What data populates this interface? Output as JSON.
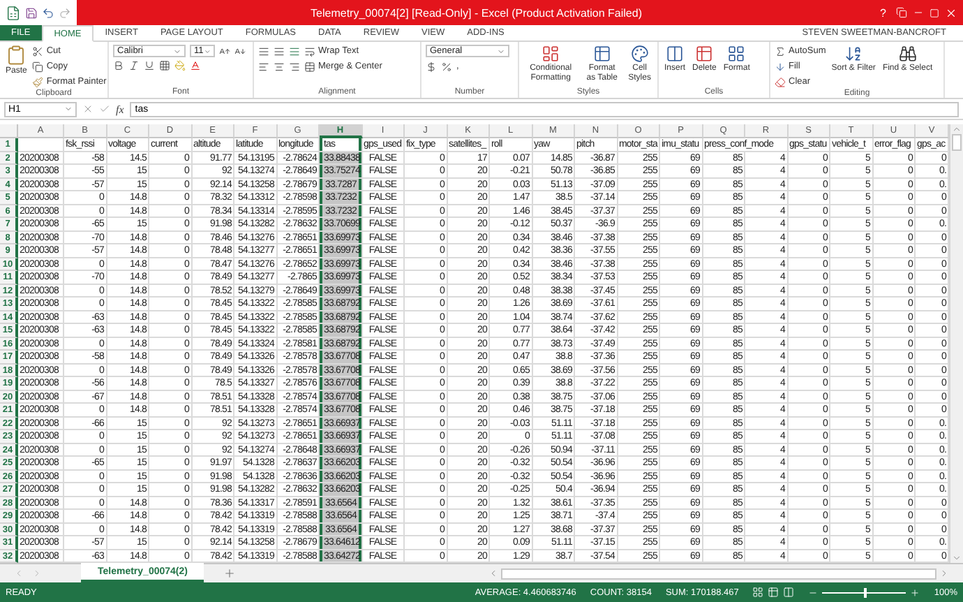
{
  "window": {
    "title": "Telemetry_00074[2]  [Read-Only] - Excel (Product Activation Failed)",
    "help": "?"
  },
  "ribbon": {
    "tabs": [
      {
        "label": "FILE",
        "kind": "file",
        "selected": false
      },
      {
        "label": "HOME",
        "kind": "tab",
        "selected": true
      },
      {
        "label": "INSERT",
        "kind": "tab",
        "selected": false
      },
      {
        "label": "PAGE LAYOUT",
        "kind": "tab",
        "selected": false
      },
      {
        "label": "FORMULAS",
        "kind": "tab",
        "selected": false
      },
      {
        "label": "DATA",
        "kind": "tab",
        "selected": false
      },
      {
        "label": "REVIEW",
        "kind": "tab",
        "selected": false
      },
      {
        "label": "VIEW",
        "kind": "tab",
        "selected": false
      },
      {
        "label": "ADD-INS",
        "kind": "tab",
        "selected": false
      }
    ],
    "account": "STEVEN SWEETMAN-BANCROFT",
    "clipboard": {
      "paste": "Paste",
      "cut": "Cut",
      "copy": "Copy",
      "format_painter": "Format Painter",
      "label": "Clipboard"
    },
    "font": {
      "name": "Calibri",
      "size": "11",
      "label": "Font"
    },
    "alignment": {
      "wrap": "Wrap Text",
      "merge": "Merge & Center",
      "label": "Alignment"
    },
    "number": {
      "format": "General",
      "comma": ",",
      "label": "Number"
    },
    "styles": {
      "conditional": "Conditional Formatting",
      "table": "Format as Table",
      "cell_styles": "Cell Styles",
      "label": "Styles"
    },
    "cells": {
      "insert": "Insert",
      "delete": "Delete",
      "format": "Format",
      "label": "Cells"
    },
    "editing": {
      "autosum": "AutoSum",
      "fill": "Fill",
      "clear": "Clear",
      "sort": "Sort & Filter",
      "find": "Find & Select",
      "label": "Editing"
    }
  },
  "formula_bar": {
    "name_box": "H1",
    "fx": "fx",
    "value": "tas"
  },
  "sheet": {
    "columns": [
      {
        "letter": "A",
        "kind": "text",
        "selected": false
      },
      {
        "letter": "B",
        "kind": "number",
        "selected": false
      },
      {
        "letter": "C",
        "kind": "number",
        "selected": false
      },
      {
        "letter": "D",
        "kind": "number",
        "selected": false
      },
      {
        "letter": "E",
        "kind": "number",
        "selected": false
      },
      {
        "letter": "F",
        "kind": "number",
        "selected": false
      },
      {
        "letter": "G",
        "kind": "number",
        "selected": false
      },
      {
        "letter": "H",
        "kind": "number",
        "selected": true
      },
      {
        "letter": "I",
        "kind": "boolean",
        "selected": false
      },
      {
        "letter": "J",
        "kind": "number",
        "selected": false
      },
      {
        "letter": "K",
        "kind": "number",
        "selected": false
      },
      {
        "letter": "L",
        "kind": "number",
        "selected": false
      },
      {
        "letter": "M",
        "kind": "number",
        "selected": false
      },
      {
        "letter": "N",
        "kind": "number",
        "selected": false
      },
      {
        "letter": "O",
        "kind": "number",
        "selected": false
      },
      {
        "letter": "P",
        "kind": "number",
        "selected": false
      },
      {
        "letter": "Q",
        "kind": "number",
        "selected": false
      },
      {
        "letter": "R",
        "kind": "number",
        "selected": false
      },
      {
        "letter": "S",
        "kind": "number",
        "selected": false
      },
      {
        "letter": "T",
        "kind": "number",
        "selected": false
      },
      {
        "letter": "U",
        "kind": "number",
        "selected": false
      },
      {
        "letter": "V",
        "kind": "number",
        "selected": false
      }
    ],
    "rows": [
      {
        "number": "1",
        "kind": "header",
        "active": true,
        "cells": [
          null,
          "fsk_rssi",
          "voltage",
          "current",
          "altitude",
          "latitude",
          "longitude",
          "tas",
          "gps_used",
          "fix_type",
          "satellites_",
          "roll",
          "yaw",
          "pitch",
          "motor_sta",
          "imu_statu",
          "press_conf_mode",
          null,
          "gps_statu",
          "vehicle_t",
          "error_flag",
          "gps_ac"
        ]
      },
      {
        "number": "2",
        "kind": "data",
        "active": false,
        "cells": [
          "20200308",
          "-58",
          "14.5",
          "0",
          "91.77",
          "54.13195",
          "-2.78624",
          "33.88438",
          "FALSE",
          "0",
          "17",
          "0.07",
          "14.85",
          "-36.87",
          "255",
          "69",
          "85",
          "4",
          "0",
          "5",
          "0",
          "0"
        ]
      },
      {
        "number": "3",
        "kind": "data",
        "active": false,
        "cells": [
          "20200308",
          "-55",
          "15",
          "0",
          "92",
          "54.13274",
          "-2.78649",
          "33.75274",
          "FALSE",
          "0",
          "20",
          "-0.21",
          "50.78",
          "-36.85",
          "255",
          "69",
          "85",
          "4",
          "0",
          "5",
          "0",
          "0."
        ]
      },
      {
        "number": "4",
        "kind": "data",
        "active": false,
        "cells": [
          "20200308",
          "-57",
          "15",
          "0",
          "92.14",
          "54.13258",
          "-2.78679",
          "33.7287",
          "FALSE",
          "0",
          "20",
          "0.03",
          "51.13",
          "-37.09",
          "255",
          "69",
          "85",
          "4",
          "0",
          "5",
          "0",
          "0."
        ]
      },
      {
        "number": "5",
        "kind": "data",
        "active": false,
        "cells": [
          "20200308",
          "0",
          "14.8",
          "0",
          "78.32",
          "54.13312",
          "-2.78598",
          "33.7232",
          "FALSE",
          "0",
          "20",
          "1.47",
          "38.5",
          "-37.14",
          "255",
          "69",
          "85",
          "4",
          "0",
          "5",
          "0",
          "0"
        ]
      },
      {
        "number": "6",
        "kind": "data",
        "active": false,
        "cells": [
          "20200308",
          "0",
          "14.8",
          "0",
          "78.34",
          "54.13314",
          "-2.78595",
          "33.7232",
          "FALSE",
          "0",
          "20",
          "1.46",
          "38.45",
          "-37.37",
          "255",
          "69",
          "85",
          "4",
          "0",
          "5",
          "0",
          "0"
        ]
      },
      {
        "number": "7",
        "kind": "data",
        "active": false,
        "cells": [
          "20200308",
          "-65",
          "15",
          "0",
          "91.98",
          "54.13282",
          "-2.78632",
          "33.70699",
          "FALSE",
          "0",
          "20",
          "-0.12",
          "50.37",
          "-36.9",
          "255",
          "69",
          "85",
          "4",
          "0",
          "5",
          "0",
          "0."
        ]
      },
      {
        "number": "8",
        "kind": "data",
        "active": false,
        "cells": [
          "20200308",
          "-70",
          "14.8",
          "0",
          "78.46",
          "54.13276",
          "-2.78651",
          "33.69973",
          "FALSE",
          "0",
          "20",
          "0.34",
          "38.46",
          "-37.38",
          "255",
          "69",
          "85",
          "4",
          "0",
          "5",
          "0",
          "0"
        ]
      },
      {
        "number": "9",
        "kind": "data",
        "active": false,
        "cells": [
          "20200308",
          "-57",
          "14.8",
          "0",
          "78.48",
          "54.13277",
          "-2.78651",
          "33.69973",
          "FALSE",
          "0",
          "20",
          "0.42",
          "38.36",
          "-37.55",
          "255",
          "69",
          "85",
          "4",
          "0",
          "5",
          "0",
          "0"
        ]
      },
      {
        "number": "10",
        "kind": "data",
        "active": false,
        "cells": [
          "20200308",
          "0",
          "14.8",
          "0",
          "78.47",
          "54.13276",
          "-2.78652",
          "33.69973",
          "FALSE",
          "0",
          "20",
          "0.34",
          "38.46",
          "-37.38",
          "255",
          "69",
          "85",
          "4",
          "0",
          "5",
          "0",
          "0"
        ]
      },
      {
        "number": "11",
        "kind": "data",
        "active": false,
        "cells": [
          "20200308",
          "-70",
          "14.8",
          "0",
          "78.49",
          "54.13277",
          "-2.7865",
          "33.69973",
          "FALSE",
          "0",
          "20",
          "0.52",
          "38.34",
          "-37.53",
          "255",
          "69",
          "85",
          "4",
          "0",
          "5",
          "0",
          "0"
        ]
      },
      {
        "number": "12",
        "kind": "data",
        "active": false,
        "cells": [
          "20200308",
          "0",
          "14.8",
          "0",
          "78.52",
          "54.13279",
          "-2.78649",
          "33.69973",
          "FALSE",
          "0",
          "20",
          "0.48",
          "38.38",
          "-37.45",
          "255",
          "69",
          "85",
          "4",
          "0",
          "5",
          "0",
          "0"
        ]
      },
      {
        "number": "13",
        "kind": "data",
        "active": false,
        "cells": [
          "20200308",
          "0",
          "14.8",
          "0",
          "78.45",
          "54.13322",
          "-2.78585",
          "33.68792",
          "FALSE",
          "0",
          "20",
          "1.26",
          "38.69",
          "-37.61",
          "255",
          "69",
          "85",
          "4",
          "0",
          "5",
          "0",
          "0"
        ]
      },
      {
        "number": "14",
        "kind": "data",
        "active": false,
        "cells": [
          "20200308",
          "-63",
          "14.8",
          "0",
          "78.45",
          "54.13322",
          "-2.78585",
          "33.68792",
          "FALSE",
          "0",
          "20",
          "1.04",
          "38.74",
          "-37.62",
          "255",
          "69",
          "85",
          "4",
          "0",
          "5",
          "0",
          "0"
        ]
      },
      {
        "number": "15",
        "kind": "data",
        "active": false,
        "cells": [
          "20200308",
          "-63",
          "14.8",
          "0",
          "78.45",
          "54.13322",
          "-2.78585",
          "33.68792",
          "FALSE",
          "0",
          "20",
          "0.77",
          "38.64",
          "-37.42",
          "255",
          "69",
          "85",
          "4",
          "0",
          "5",
          "0",
          "0"
        ]
      },
      {
        "number": "16",
        "kind": "data",
        "active": false,
        "cells": [
          "20200308",
          "0",
          "14.8",
          "0",
          "78.49",
          "54.13324",
          "-2.78581",
          "33.68792",
          "FALSE",
          "0",
          "20",
          "0.77",
          "38.73",
          "-37.49",
          "255",
          "69",
          "85",
          "4",
          "0",
          "5",
          "0",
          "0"
        ]
      },
      {
        "number": "17",
        "kind": "data",
        "active": false,
        "cells": [
          "20200308",
          "-58",
          "14.8",
          "0",
          "78.49",
          "54.13326",
          "-2.78578",
          "33.67708",
          "FALSE",
          "0",
          "20",
          "0.47",
          "38.8",
          "-37.36",
          "255",
          "69",
          "85",
          "4",
          "0",
          "5",
          "0",
          "0"
        ]
      },
      {
        "number": "18",
        "kind": "data",
        "active": false,
        "cells": [
          "20200308",
          "0",
          "14.8",
          "0",
          "78.49",
          "54.13326",
          "-2.78578",
          "33.67708",
          "FALSE",
          "0",
          "20",
          "0.65",
          "38.69",
          "-37.56",
          "255",
          "69",
          "85",
          "4",
          "0",
          "5",
          "0",
          "0"
        ]
      },
      {
        "number": "19",
        "kind": "data",
        "active": false,
        "cells": [
          "20200308",
          "-56",
          "14.8",
          "0",
          "78.5",
          "54.13327",
          "-2.78576",
          "33.67708",
          "FALSE",
          "0",
          "20",
          "0.39",
          "38.8",
          "-37.22",
          "255",
          "69",
          "85",
          "4",
          "0",
          "5",
          "0",
          "0"
        ]
      },
      {
        "number": "20",
        "kind": "data",
        "active": false,
        "cells": [
          "20200308",
          "-67",
          "14.8",
          "0",
          "78.51",
          "54.13328",
          "-2.78574",
          "33.67708",
          "FALSE",
          "0",
          "20",
          "0.38",
          "38.75",
          "-37.06",
          "255",
          "69",
          "85",
          "4",
          "0",
          "5",
          "0",
          "0"
        ]
      },
      {
        "number": "21",
        "kind": "data",
        "active": false,
        "cells": [
          "20200308",
          "0",
          "14.8",
          "0",
          "78.51",
          "54.13328",
          "-2.78574",
          "33.67708",
          "FALSE",
          "0",
          "20",
          "0.46",
          "38.75",
          "-37.18",
          "255",
          "69",
          "85",
          "4",
          "0",
          "5",
          "0",
          "0"
        ]
      },
      {
        "number": "22",
        "kind": "data",
        "active": false,
        "cells": [
          "20200308",
          "-66",
          "15",
          "0",
          "92",
          "54.13273",
          "-2.78651",
          "33.66937",
          "FALSE",
          "0",
          "20",
          "-0.03",
          "51.11",
          "-37.18",
          "255",
          "69",
          "85",
          "4",
          "0",
          "5",
          "0",
          "0."
        ]
      },
      {
        "number": "23",
        "kind": "data",
        "active": false,
        "cells": [
          "20200308",
          "0",
          "15",
          "0",
          "92",
          "54.13273",
          "-2.78651",
          "33.66937",
          "FALSE",
          "0",
          "20",
          "0",
          "51.11",
          "-37.08",
          "255",
          "69",
          "85",
          "4",
          "0",
          "5",
          "0",
          "0."
        ]
      },
      {
        "number": "24",
        "kind": "data",
        "active": false,
        "cells": [
          "20200308",
          "0",
          "15",
          "0",
          "92",
          "54.13274",
          "-2.78648",
          "33.66937",
          "FALSE",
          "0",
          "20",
          "-0.26",
          "50.94",
          "-37.11",
          "255",
          "69",
          "85",
          "4",
          "0",
          "5",
          "0",
          "0."
        ]
      },
      {
        "number": "25",
        "kind": "data",
        "active": false,
        "cells": [
          "20200308",
          "-65",
          "15",
          "0",
          "91.97",
          "54.1328",
          "-2.78637",
          "33.66203",
          "FALSE",
          "0",
          "20",
          "-0.32",
          "50.54",
          "-36.96",
          "255",
          "69",
          "85",
          "4",
          "0",
          "5",
          "0",
          "0."
        ]
      },
      {
        "number": "26",
        "kind": "data",
        "active": false,
        "cells": [
          "20200308",
          "0",
          "15",
          "0",
          "91.98",
          "54.1328",
          "-2.78636",
          "33.66203",
          "FALSE",
          "0",
          "20",
          "-0.32",
          "50.54",
          "-36.96",
          "255",
          "69",
          "85",
          "4",
          "0",
          "5",
          "0",
          "0."
        ]
      },
      {
        "number": "27",
        "kind": "data",
        "active": false,
        "cells": [
          "20200308",
          "0",
          "15",
          "0",
          "91.98",
          "54.13282",
          "-2.78632",
          "33.66203",
          "FALSE",
          "0",
          "20",
          "-0.25",
          "50.4",
          "-36.94",
          "255",
          "69",
          "85",
          "4",
          "0",
          "5",
          "0",
          "0."
        ]
      },
      {
        "number": "28",
        "kind": "data",
        "active": false,
        "cells": [
          "20200308",
          "0",
          "14.8",
          "0",
          "78.36",
          "54.13317",
          "-2.78591",
          "33.6564",
          "FALSE",
          "0",
          "20",
          "1.32",
          "38.61",
          "-37.35",
          "255",
          "69",
          "85",
          "4",
          "0",
          "5",
          "0",
          "0"
        ]
      },
      {
        "number": "29",
        "kind": "data",
        "active": false,
        "cells": [
          "20200308",
          "-66",
          "14.8",
          "0",
          "78.42",
          "54.13319",
          "-2.78588",
          "33.6564",
          "FALSE",
          "0",
          "20",
          "1.25",
          "38.71",
          "-37.4",
          "255",
          "69",
          "85",
          "4",
          "0",
          "5",
          "0",
          "0"
        ]
      },
      {
        "number": "30",
        "kind": "data",
        "active": false,
        "cells": [
          "20200308",
          "0",
          "14.8",
          "0",
          "78.42",
          "54.13319",
          "-2.78588",
          "33.6564",
          "FALSE",
          "0",
          "20",
          "1.27",
          "38.68",
          "-37.37",
          "255",
          "69",
          "85",
          "4",
          "0",
          "5",
          "0",
          "0"
        ]
      },
      {
        "number": "31",
        "kind": "data",
        "active": false,
        "cells": [
          "20200308",
          "-57",
          "15",
          "0",
          "92.14",
          "54.13258",
          "-2.78679",
          "33.64612",
          "FALSE",
          "0",
          "20",
          "0.09",
          "51.11",
          "-37.15",
          "255",
          "69",
          "85",
          "4",
          "0",
          "5",
          "0",
          "0."
        ]
      },
      {
        "number": "32",
        "kind": "data",
        "active": false,
        "cells": [
          "20200308",
          "-63",
          "14.8",
          "0",
          "78.42",
          "54.13319",
          "-2.78588",
          "33.64272",
          "FALSE",
          "0",
          "20",
          "1.29",
          "38.7",
          "-37.54",
          "255",
          "69",
          "85",
          "4",
          "0",
          "5",
          "0",
          "0"
        ]
      }
    ]
  },
  "sheet_tabs": [
    {
      "label": "Telemetry_00074(2)",
      "selected": true
    }
  ],
  "status_bar": {
    "state": "READY",
    "average": "AVERAGE: 4.460683746",
    "count": "COUNT: 38154",
    "sum": "SUM: 170188.467",
    "zoom": {
      "level": 0.5,
      "reading": "100%"
    }
  }
}
